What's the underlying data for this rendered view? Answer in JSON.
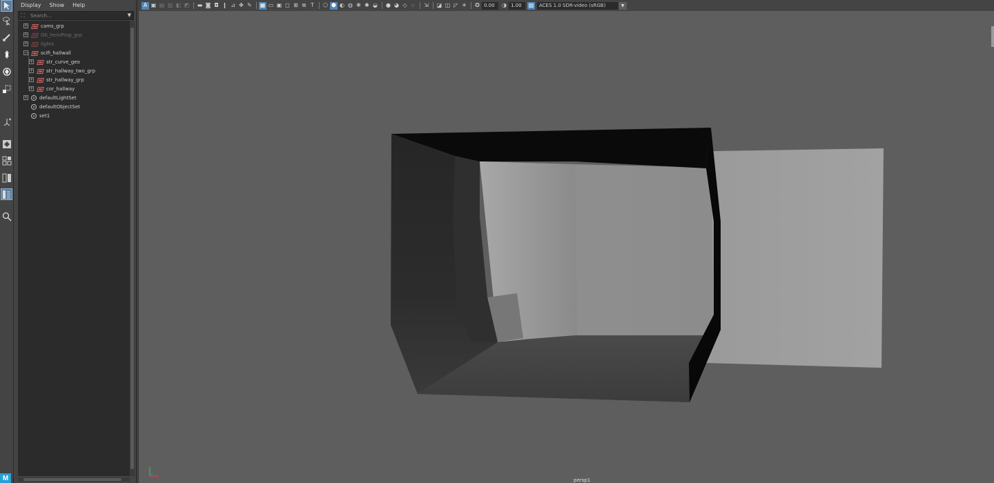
{
  "outliner": {
    "menu": [
      "Display",
      "Show",
      "Help"
    ],
    "search_placeholder": "Search...",
    "items": [
      {
        "label": "cams_grp",
        "type": "group",
        "dimmed": false
      },
      {
        "label": "Ob_heroProp_grp",
        "type": "group",
        "dimmed": true
      },
      {
        "label": "lights",
        "type": "group",
        "dimmed": true
      },
      {
        "label": "scifi_hallwall",
        "type": "group",
        "dimmed": false
      },
      {
        "label": "str_curve_geo",
        "type": "group",
        "dimmed": false
      },
      {
        "label": "str_hallway_two_grp",
        "type": "group",
        "dimmed": false
      },
      {
        "label": "str_hallway_grp",
        "type": "group",
        "dimmed": false
      },
      {
        "label": "cor_hallway",
        "type": "group",
        "dimmed": false
      },
      {
        "label": "defaultLightSet",
        "type": "set",
        "dimmed": false
      },
      {
        "label": "defaultObjectSet",
        "type": "set",
        "dimmed": false
      },
      {
        "label": "set1",
        "type": "set",
        "dimmed": false
      }
    ]
  },
  "viewport_toolbar": {
    "exposure": "0.00",
    "gamma": "1.00",
    "color_space": "ACES 1.0 SDR-video (sRGB)"
  },
  "viewport": {
    "camera_label": "persp1"
  },
  "colors": {
    "selection_accent": "#5285b5",
    "maya_logo": "#27a0d9",
    "viewport_background": "#5e5e5e"
  }
}
